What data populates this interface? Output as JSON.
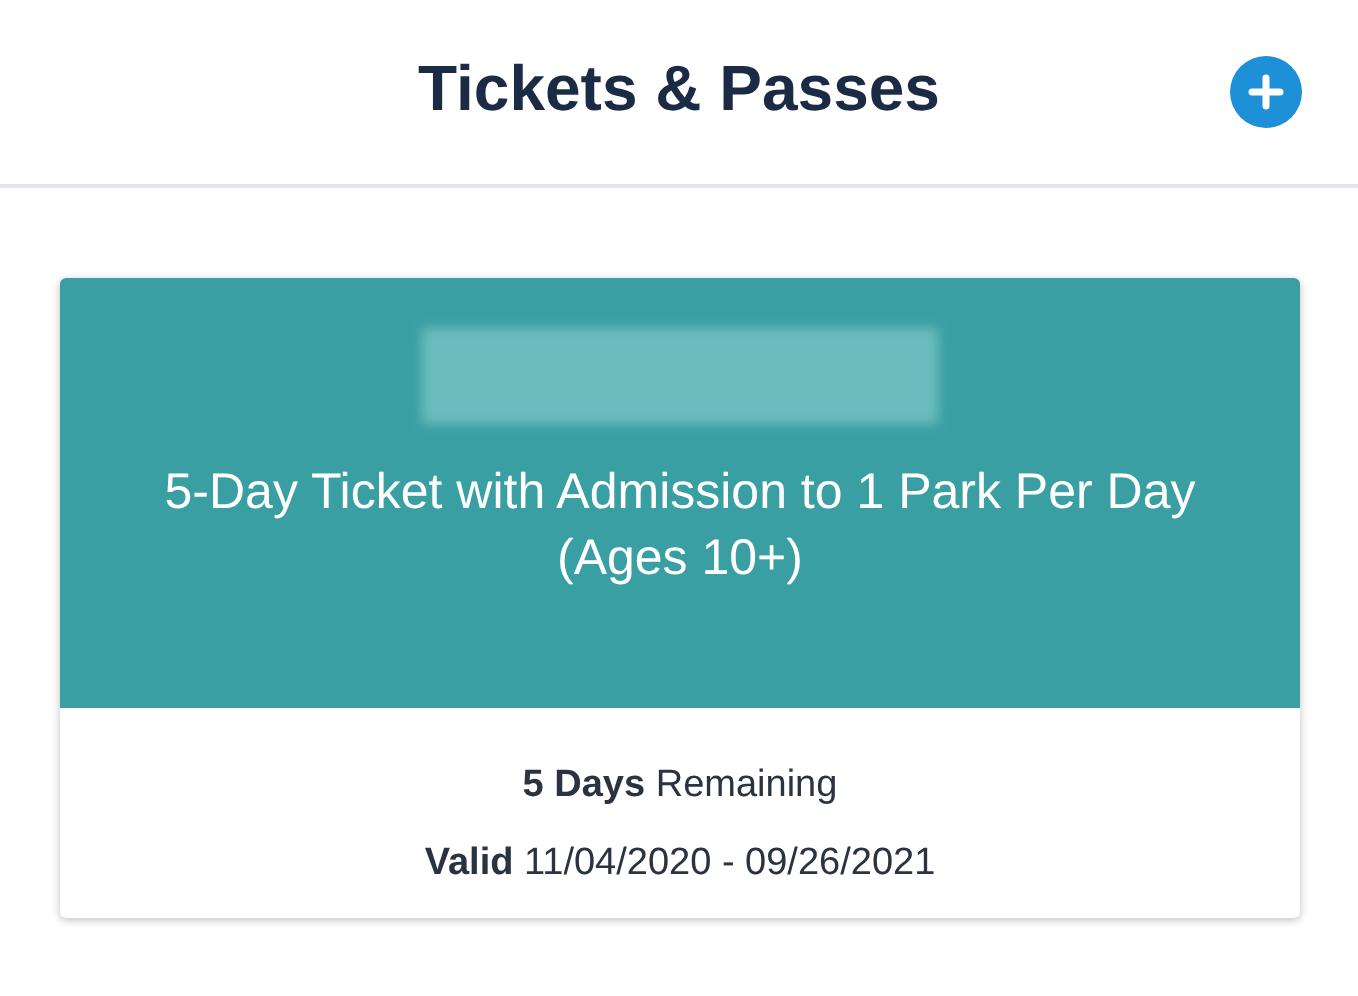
{
  "header": {
    "title": "Tickets & Passes"
  },
  "ticket": {
    "name": "5-Day Ticket with Admission to 1 Park Per Day",
    "ages": "(Ages 10+)",
    "remaining": "**5 Days** Remaining",
    "validity": "**Valid** 11/04/2020 - 09/26/2021"
  }
}
